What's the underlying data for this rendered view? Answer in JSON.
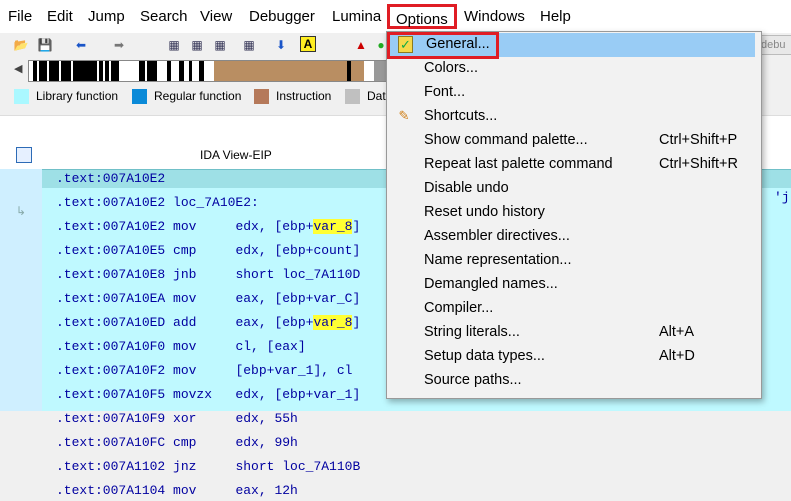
{
  "menubar": {
    "file": "File",
    "edit": "Edit",
    "jump": "Jump",
    "search": "Search",
    "view": "View",
    "debugger": "Debugger",
    "lumina": "Lumina",
    "options": "Options",
    "windows": "Windows",
    "help": "Help"
  },
  "legend": {
    "items": [
      {
        "label": "Library function",
        "color": "#aaf8ff"
      },
      {
        "label": "Regular function",
        "color": "#0b8ad8"
      },
      {
        "label": "Instruction",
        "color": "#b5795a"
      },
      {
        "label": "Dat",
        "color": "#c0c0c0"
      }
    ]
  },
  "tab": {
    "title": "IDA View-EIP",
    "partial_right": "debu"
  },
  "code": {
    "rows": [
      {
        "addr": ".text:007A10E2",
        "rest": ""
      },
      {
        "addr": ".text:007A10E2",
        "rest": " loc_7A10E2:"
      },
      {
        "addr": ".text:007A10E2",
        "mnem": " mov",
        "pre": "     edx, [ebp+",
        "hl": "var_8",
        "post": "]"
      },
      {
        "addr": ".text:007A10E5",
        "mnem": " cmp",
        "pre": "     edx, [ebp+count]",
        "hl": "",
        "post": ""
      },
      {
        "addr": ".text:007A10E8",
        "mnem": " jnb",
        "pre": "     short loc_7A110D",
        "hl": "",
        "post": ""
      },
      {
        "addr": ".text:007A10EA",
        "mnem": " mov",
        "pre": "     eax, [ebp+var_C]",
        "hl": "",
        "post": ""
      },
      {
        "addr": ".text:007A10ED",
        "mnem": " add",
        "pre": "     eax, [ebp+",
        "hl": "var_8",
        "post": "]"
      },
      {
        "addr": ".text:007A10F0",
        "mnem": " mov",
        "pre": "     cl, [eax]",
        "hl": "",
        "post": ""
      },
      {
        "addr": ".text:007A10F2",
        "mnem": " mov",
        "pre": "     [ebp+var_1], cl",
        "hl": "",
        "post": ""
      },
      {
        "addr": ".text:007A10F5",
        "mnem": " movzx",
        "pre": "   edx, [ebp+var_1]",
        "hl": "",
        "post": ""
      },
      {
        "addr": ".text:007A10F9",
        "mnem": " xor",
        "pre": "     edx, 55h",
        "hl": "",
        "post": ""
      },
      {
        "addr": ".text:007A10FC",
        "mnem": " cmp",
        "pre": "     edx, 99h",
        "hl": "",
        "post": ""
      },
      {
        "addr": ".text:007A1102",
        "mnem": " jnz",
        "pre": "     short loc_7A110B",
        "hl": "",
        "post": ""
      },
      {
        "addr": ".text:007A1104",
        "mnem": " mov",
        "pre": "     eax, 12h",
        "hl": "",
        "post": ""
      }
    ],
    "tail_text": "'j"
  },
  "dropdown": {
    "items": [
      {
        "label": "General...",
        "shortcut": "",
        "icon": "checklist-icon",
        "selected": true
      },
      {
        "label": "Colors...",
        "shortcut": "",
        "icon": "",
        "selected": false
      },
      {
        "label": "Font...",
        "shortcut": "",
        "icon": "",
        "selected": false
      },
      {
        "label": "Shortcuts...",
        "shortcut": "",
        "icon": "pencil-icon",
        "selected": false
      },
      {
        "label": "Show command palette...",
        "shortcut": "Ctrl+Shift+P",
        "icon": "",
        "selected": false
      },
      {
        "label": "Repeat last palette command",
        "shortcut": "Ctrl+Shift+R",
        "icon": "",
        "selected": false
      },
      {
        "label": "Disable undo",
        "shortcut": "",
        "icon": "",
        "selected": false
      },
      {
        "label": "Reset undo history",
        "shortcut": "",
        "icon": "",
        "selected": false
      },
      {
        "label": "Assembler directives...",
        "shortcut": "",
        "icon": "",
        "selected": false
      },
      {
        "label": "Name representation...",
        "shortcut": "",
        "icon": "",
        "selected": false
      },
      {
        "label": "Demangled names...",
        "shortcut": "",
        "icon": "",
        "selected": false
      },
      {
        "label": "Compiler...",
        "shortcut": "",
        "icon": "",
        "selected": false
      },
      {
        "label": "String literals...",
        "shortcut": "Alt+A",
        "icon": "",
        "selected": false
      },
      {
        "label": "Setup data types...",
        "shortcut": "Alt+D",
        "icon": "",
        "selected": false
      },
      {
        "label": "Source paths...",
        "shortcut": "",
        "icon": "",
        "selected": false
      }
    ]
  }
}
